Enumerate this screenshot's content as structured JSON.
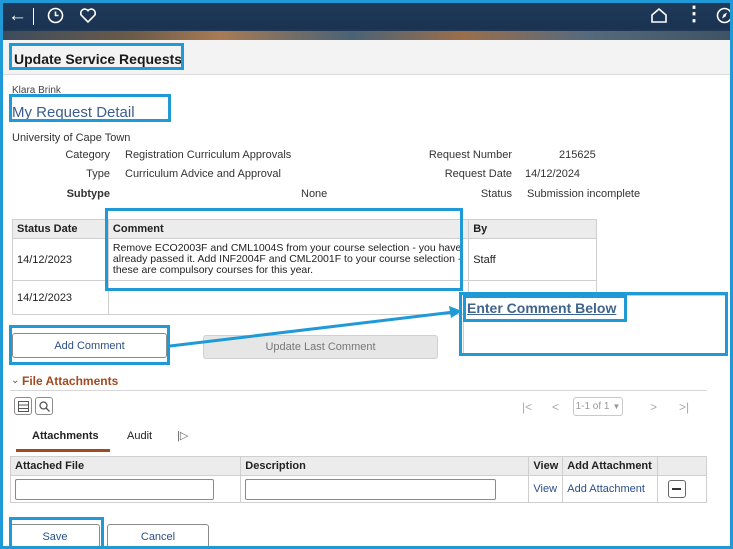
{
  "topbar": {
    "icons": [
      "back-arrow-icon",
      "history-clock-icon",
      "favorite-heart-icon",
      "home-icon",
      "actions-menu-icon",
      "navbar-compass-icon"
    ]
  },
  "header": {
    "title": "Update Service Requests"
  },
  "user": {
    "name": "Klara Brink"
  },
  "section_title": "My Request Detail",
  "details": {
    "institution": "University of Cape Town",
    "category_label": "Category",
    "category_value": "Registration Curriculum Approvals",
    "type_label": "Type",
    "type_value": "Curriculum Advice and Approval",
    "subtype_label": "Subtype",
    "subtype_value": "None",
    "request_number_label": "Request Number",
    "request_number_value": "215625",
    "request_date_label": "Request Date",
    "request_date_value": "14/12/2024",
    "status_label": "Status",
    "status_value": "Submission incomplete"
  },
  "comments_table": {
    "headers": [
      "Status Date",
      "Comment",
      "By"
    ],
    "rows": [
      {
        "date": "14/12/2023",
        "comment": "Remove ECO2003F and CML1004S from your course selection - you have already passed it. Add INF2004F and CML2001F to your course selection - these are compulsory courses for this year.",
        "by": "Staff"
      },
      {
        "date": "14/12/2023",
        "comment": "",
        "by": ""
      }
    ]
  },
  "comment_box": {
    "title": "Enter Comment Below"
  },
  "buttons": {
    "add_comment": "Add Comment",
    "update_last_comment": "Update Last Comment",
    "save": "Save",
    "cancel": "Cancel"
  },
  "file_attachments": {
    "title": "File Attachments",
    "pagination": "1-1 of 1",
    "tabs": [
      "Attachments",
      "Audit"
    ],
    "headers": [
      "Attached File",
      "Description",
      "View",
      "Add Attachment"
    ],
    "row": {
      "view_link": "View",
      "add_link": "Add Attachment"
    }
  },
  "colors": {
    "highlight": "#1f9ad6",
    "header_accent": "#a24a21",
    "link": "#2a4f8a",
    "section_title": "#3a5d8f"
  }
}
